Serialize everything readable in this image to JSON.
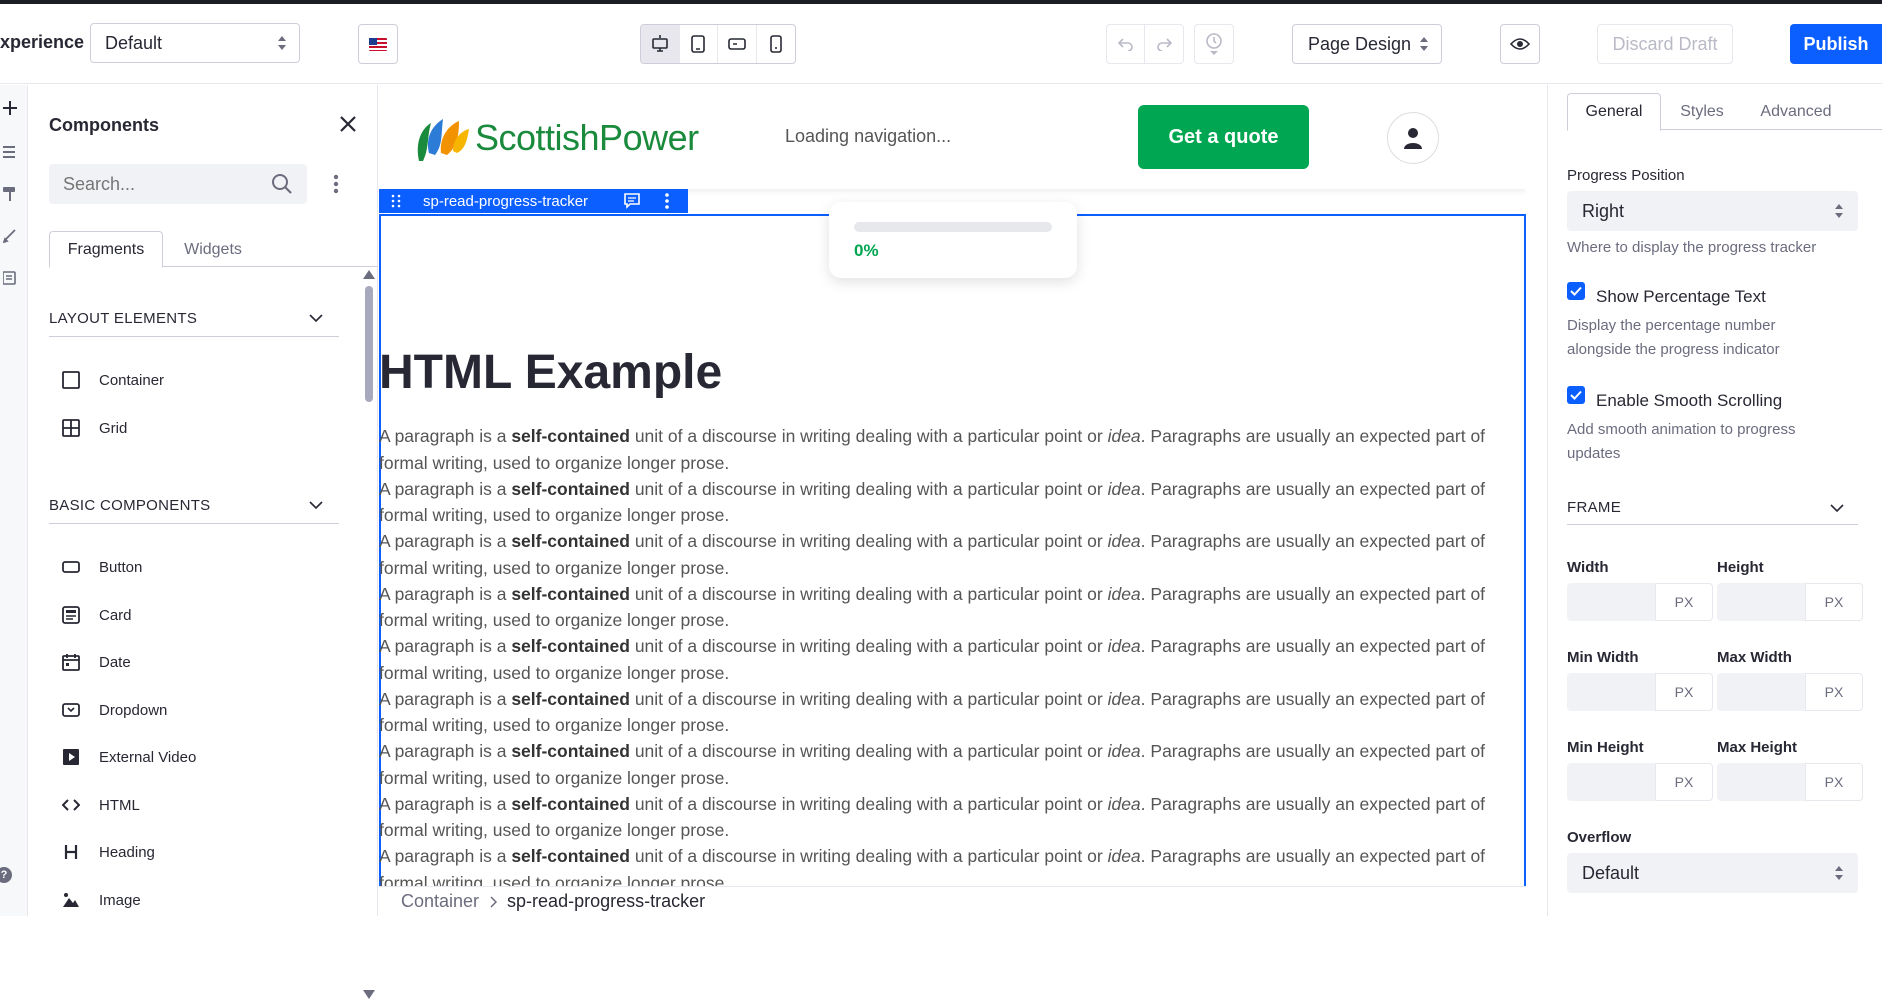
{
  "toolbar": {
    "experience_label": "xperience",
    "experience_value": "Default",
    "page_design_value": "Page Design",
    "discard_label": "Discard Draft",
    "publish_label": "Publish"
  },
  "components_panel": {
    "title": "Components",
    "search_placeholder": "Search...",
    "tabs": [
      "Fragments",
      "Widgets"
    ],
    "sections": [
      {
        "title": "LAYOUT ELEMENTS",
        "items": [
          "Container",
          "Grid"
        ]
      },
      {
        "title": "BASIC COMPONENTS",
        "items": [
          "Button",
          "Card",
          "Date",
          "Dropdown",
          "External Video",
          "HTML",
          "Heading",
          "Image"
        ]
      }
    ]
  },
  "canvas": {
    "logo_text": "ScottishPower",
    "loading_text": "Loading navigation...",
    "quote_button": "Get a quote",
    "fragment_name": "sp-read-progress-tracker",
    "progress_percent_text": "0%",
    "progress_value": 0,
    "heading": "HTML Example",
    "paragraph": {
      "before": "A paragraph is a ",
      "bold": "self-contained",
      "middle": " unit of a discourse in writing dealing with a particular point or ",
      "italic": "idea",
      "after": ". Paragraphs are usually an expected part of formal writing, used to organize longer prose.",
      "repeat": 9
    },
    "breadcrumb": [
      "Container",
      "sp-read-progress-tracker"
    ]
  },
  "config_panel": {
    "tabs": [
      "General",
      "Styles",
      "Advanced"
    ],
    "progress_position_label": "Progress Position",
    "progress_position_value": "Right",
    "progress_position_help": "Where to display the progress tracker",
    "show_percentage_label": "Show Percentage Text",
    "show_percentage_help": "Display the percentage number alongside the progress indicator",
    "smooth_scrolling_label": "Enable Smooth Scrolling",
    "smooth_scrolling_help": "Add smooth animation to progress updates",
    "frame_title": "FRAME",
    "width_label": "Width",
    "height_label": "Height",
    "min_width_label": "Min Width",
    "max_width_label": "Max Width",
    "min_height_label": "Min Height",
    "max_height_label": "Max Height",
    "unit": "PX",
    "overflow_label": "Overflow",
    "overflow_value": "Default"
  },
  "colors": {
    "accent": "#0b5fff",
    "brand_green": "#00a651"
  }
}
